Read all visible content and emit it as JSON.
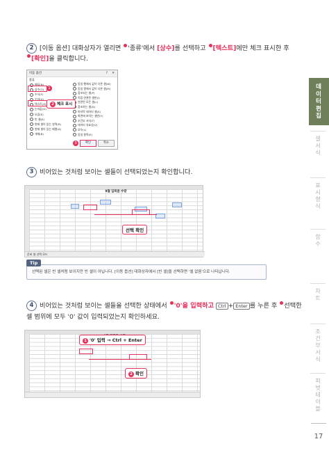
{
  "step2": {
    "num": "2",
    "line1_a": "[이동 옵션] 대화상자가 열리면",
    "line1_b": "'종류'에서",
    "line1_c": "[상수]",
    "line1_d": "를 선택하고",
    "line1_e": "[텍스트]",
    "line1_f": "에만 체크 표시한 후",
    "line2_a": "[확인]",
    "line2_b": "을 클릭합니다."
  },
  "dialog": {
    "title": "이동 옵션",
    "help": "?",
    "close": "✕",
    "group": "종류",
    "left_options": [
      "메모(N)",
      "상수(O)",
      "수식(F)",
      "숫자(U)",
      "텍스트(X)",
      "논리값(G)",
      "오류(E)",
      "빈 셀(K)",
      "현재 셀이 있는 영역(R)",
      "현재 셀이 있는 배열(A)",
      "개체(B)"
    ],
    "right_options": [
      "동일 행에서 값이 다른 셀(W)",
      "동일 열에서 값이 다른 셀(M)",
      "참조되는 셀(P)",
      "직접 연관된 셀만(I)",
      "연관된 모든 셀(L)",
      "참조하는 셀(D)",
      "마지막 데이터 셀(S)",
      "화면에 보이는 셀만(Y)",
      "조건부 서식(T)",
      "데이터 유효성(V)",
      "모두(L)",
      "동일 항목(E)"
    ],
    "ok": "확인",
    "cancel": "취소",
    "callout1": "1",
    "callout2_num": "2",
    "callout2_text": "체크 표시",
    "callout3": "3"
  },
  "step3": {
    "num": "3",
    "text": "비어있는 것처럼 보이는 셀들이 선택되었는지 확인합니다."
  },
  "sheet1": {
    "title": "9월 입퇴원 수량",
    "callout": "선택 확인",
    "status": "준비  셀 선택 모드"
  },
  "tip": {
    "label": "Tip",
    "text": "선택된 셀은 빈 셀처럼 보이지만 빈 셀이 아닙니다. [이동 옵션] 대화상자에서 [빈 셀]을 선택하면 '셀 없음'으로 나타납니다."
  },
  "step4": {
    "num": "4",
    "line1_a": "비어있는 것처럼 보이는 셀들을 선택한 상태에서",
    "line1_b": "'0'을 입력하고",
    "line1_c": "Ctrl",
    "line1_d": "+",
    "line1_e": "Enter",
    "line1_f": "를 누른 후",
    "line1_g": "선택한",
    "line2": "셀 범위에 모두 '0' 값이 입력되었는지 확인하세요."
  },
  "sheet2": {
    "title": "9월 입퇴원 수량",
    "callout1_num": "1",
    "callout1_text": "'0' 입력 → Ctrl + Enter",
    "callout2_num": "2",
    "callout2_text": "확인"
  },
  "sidebar": {
    "active": "데이터 편집",
    "tabs": [
      "셀 서식",
      "표시 형식",
      "함수",
      "차트",
      "조건부 서식",
      "피벗 테이블"
    ],
    "active_color": "#6f7f5a"
  },
  "page_number": "17"
}
